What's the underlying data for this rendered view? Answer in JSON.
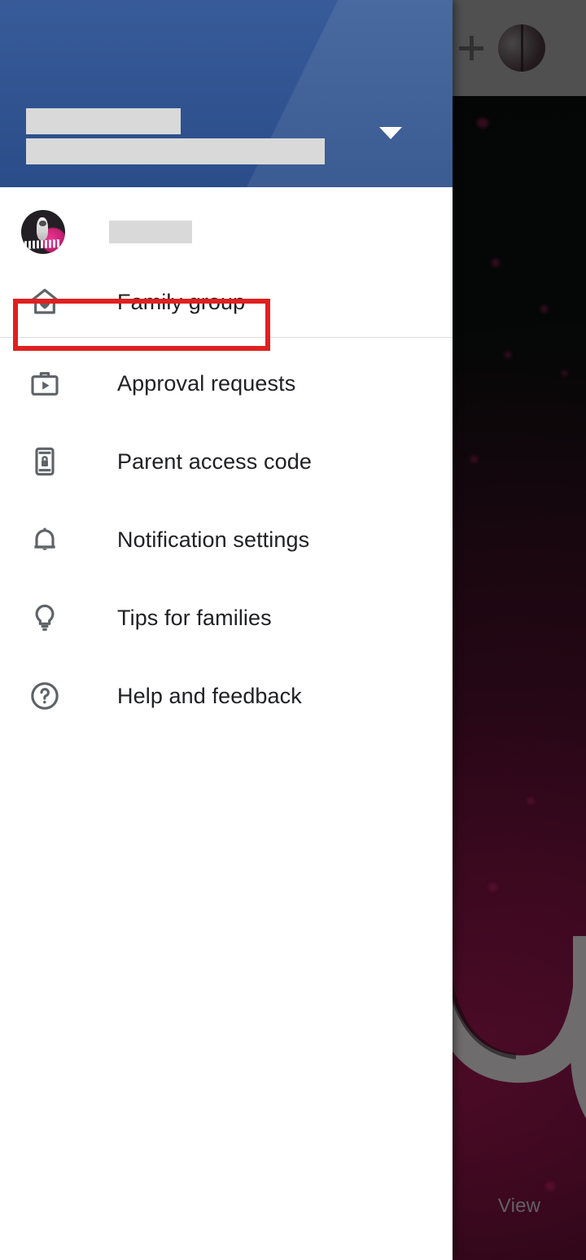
{
  "drawer": {
    "header": {
      "redacted_line_1": "",
      "redacted_line_2": "",
      "caret_icon": "chevron-down-icon"
    },
    "account": {
      "avatar_icon": "account-avatar",
      "name_redacted": ""
    },
    "highlighted_item": "Family group",
    "items": [
      {
        "label": "Family group",
        "icon": "family-home-heart-icon",
        "highlighted": true
      },
      {
        "label": "Approval requests",
        "icon": "approval-bag-play-icon",
        "highlighted": false
      },
      {
        "label": "Parent access code",
        "icon": "phone-lock-icon",
        "highlighted": false
      },
      {
        "label": "Notification settings",
        "icon": "bell-icon",
        "highlighted": false
      },
      {
        "label": "Tips for families",
        "icon": "lightbulb-icon",
        "highlighted": false
      },
      {
        "label": "Help and feedback",
        "icon": "help-circle-icon",
        "highlighted": false
      }
    ]
  },
  "background_app": {
    "topbar": {
      "add_icon": "plus-icon",
      "profile_icon": "profile-avatar"
    },
    "view_label": "View"
  },
  "colors": {
    "header_blue": "#2d5293",
    "highlight_red": "#e02020",
    "icon_gray": "#5f6368",
    "text_primary": "#202124",
    "redaction_gray": "#d9d9d9",
    "divider_gray": "#dadce0",
    "view_text_gray": "#9a9297"
  }
}
